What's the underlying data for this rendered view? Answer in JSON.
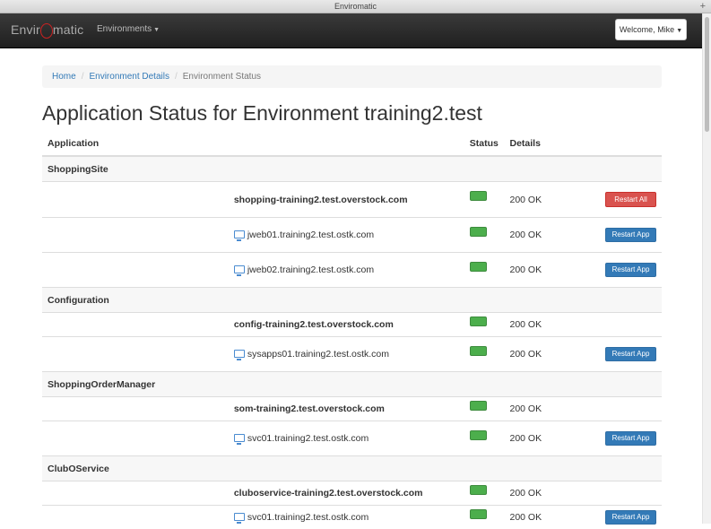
{
  "window": {
    "title": "Enviromatic"
  },
  "navbar": {
    "brand_prefix": "Envir",
    "brand_suffix": "matic",
    "environments_label": "Environments",
    "welcome_label": "Welcome, Mike"
  },
  "breadcrumb": {
    "home": "Home",
    "environment_details": "Environment Details",
    "current": "Environment Status"
  },
  "page": {
    "title": "Application Status for Environment training2.test"
  },
  "table": {
    "headers": {
      "application": "Application",
      "status": "Status",
      "details": "Details"
    },
    "groups": [
      {
        "name": "ShoppingSite",
        "lb_host": "shopping-training2.test.overstock.com",
        "lb_details": "200 OK",
        "lb_action": "Restart All",
        "servers": [
          {
            "host": "jweb01.training2.test.ostk.com",
            "details": "200 OK",
            "action": "Restart App"
          },
          {
            "host": "jweb02.training2.test.ostk.com",
            "details": "200 OK",
            "action": "Restart App"
          }
        ]
      },
      {
        "name": "Configuration",
        "lb_host": "config-training2.test.overstock.com",
        "lb_details": "200 OK",
        "servers": [
          {
            "host": "sysapps01.training2.test.ostk.com",
            "details": "200 OK",
            "action": "Restart App"
          }
        ]
      },
      {
        "name": "ShoppingOrderManager",
        "lb_host": "som-training2.test.overstock.com",
        "lb_details": "200 OK",
        "servers": [
          {
            "host": "svc01.training2.test.ostk.com",
            "details": "200 OK",
            "action": "Restart App"
          }
        ]
      },
      {
        "name": "ClubOService",
        "lb_host": "cluboservice-training2.test.overstock.com",
        "lb_details": "200 OK",
        "servers": [
          {
            "host": "svc01.training2.test.ostk.com",
            "details": "200 OK",
            "action": "Restart App"
          }
        ]
      }
    ]
  },
  "colors": {
    "status_ok": "#4cae4c",
    "danger": "#d9534f",
    "primary": "#337ab7",
    "brand_o": "#cc2222"
  }
}
